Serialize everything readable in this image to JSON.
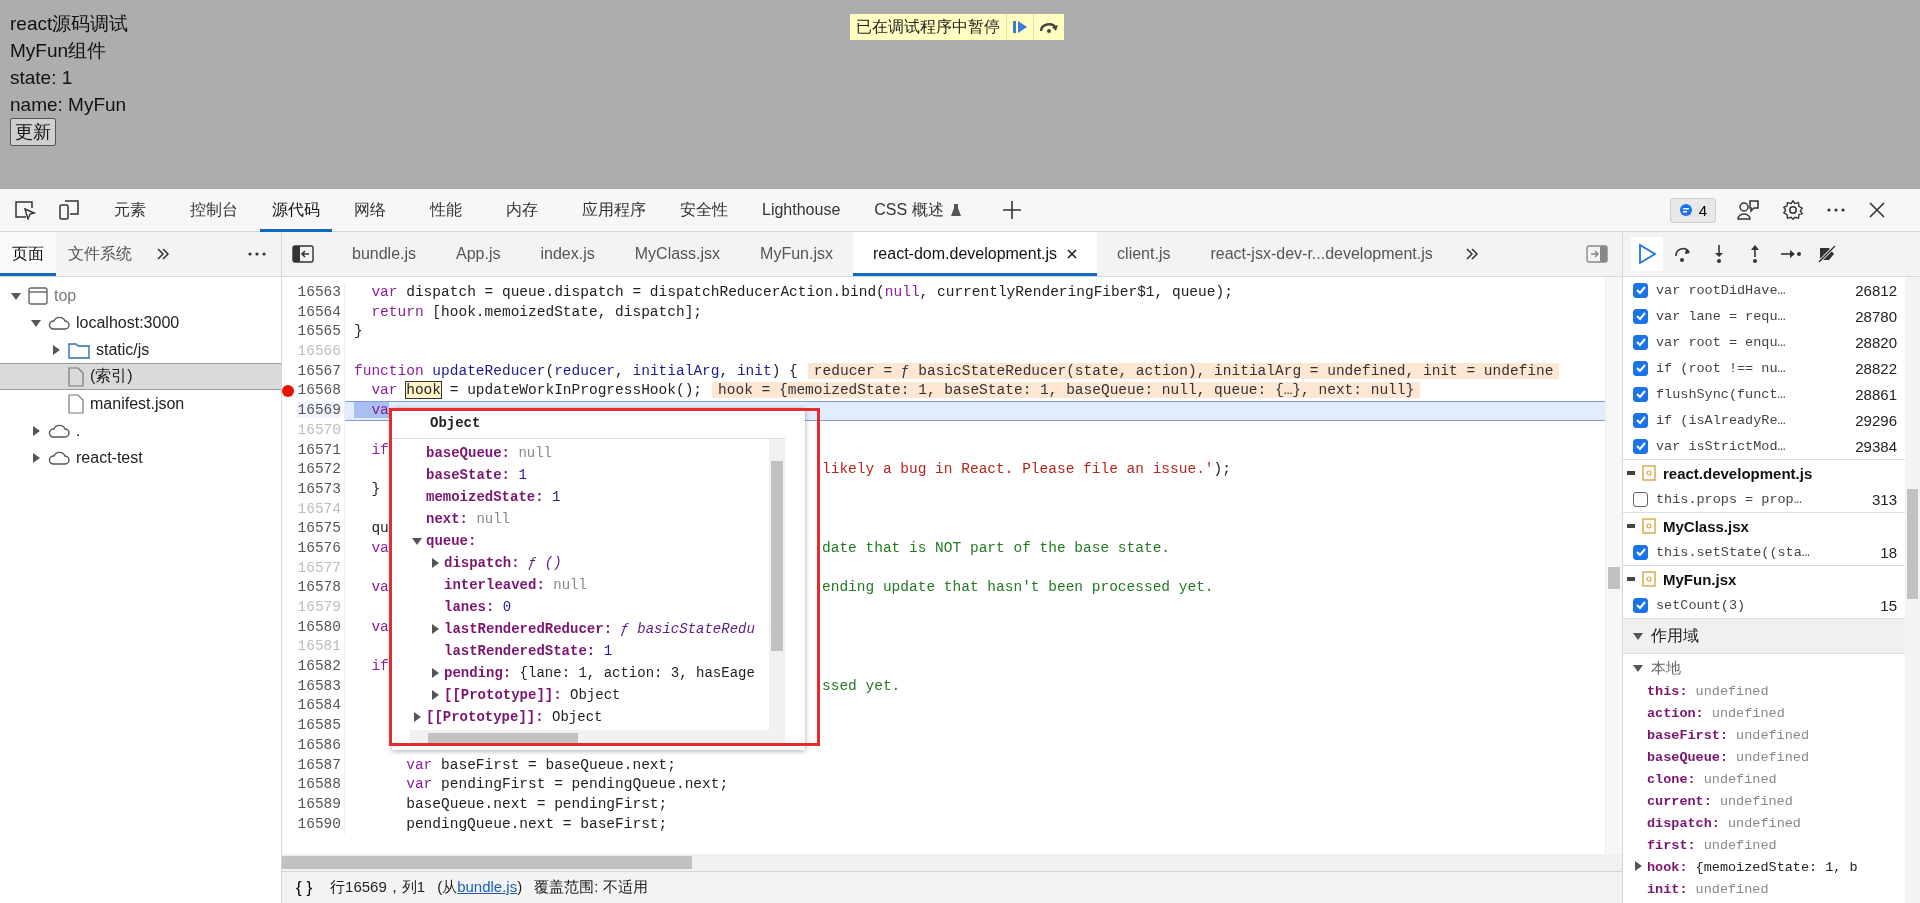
{
  "page": {
    "lines": [
      "react源码调试",
      "MyFun组件",
      "state: 1",
      "name: MyFun"
    ],
    "button": "更新"
  },
  "paused_banner": {
    "text": "已在调试程序中暂停"
  },
  "devtools_tabs": [
    {
      "label": "元素",
      "selected": false,
      "experimental": false
    },
    {
      "label": "控制台",
      "selected": false,
      "experimental": false
    },
    {
      "label": "源代码",
      "selected": true,
      "experimental": false
    },
    {
      "label": "网络",
      "selected": false,
      "experimental": false
    },
    {
      "label": "性能",
      "selected": false,
      "experimental": false
    },
    {
      "label": "内存",
      "selected": false,
      "experimental": false
    },
    {
      "label": "应用程序",
      "selected": false,
      "experimental": false
    },
    {
      "label": "安全性",
      "selected": false,
      "experimental": false
    },
    {
      "label": "Lighthouse",
      "selected": false,
      "experimental": false
    },
    {
      "label": "CSS 概述",
      "selected": false,
      "experimental": true
    }
  ],
  "issues_badge": {
    "count": "4"
  },
  "navigator": {
    "tabs": [
      {
        "label": "页面",
        "selected": true
      },
      {
        "label": "文件系统",
        "selected": false
      }
    ],
    "tree": [
      {
        "label": "top",
        "kind": "frame",
        "expanded": true,
        "selected": false,
        "children": [
          {
            "label": "localhost:3000",
            "kind": "domain",
            "expanded": true,
            "selected": false,
            "children": [
              {
                "label": "static/js",
                "kind": "folder",
                "expanded": false,
                "selected": false
              },
              {
                "label": "(索引)",
                "kind": "file",
                "selected": true
              },
              {
                "label": "manifest.json",
                "kind": "file",
                "selected": false
              }
            ]
          },
          {
            "label": ".",
            "kind": "domain",
            "expanded": false,
            "selected": false
          },
          {
            "label": "react-test",
            "kind": "domain",
            "expanded": false,
            "selected": false
          }
        ]
      }
    ]
  },
  "editor": {
    "tabs": [
      {
        "label": "bundle.js",
        "selected": false
      },
      {
        "label": "App.js",
        "selected": false
      },
      {
        "label": "index.js",
        "selected": false
      },
      {
        "label": "MyClass.jsx",
        "selected": false
      },
      {
        "label": "MyFun.jsx",
        "selected": false
      },
      {
        "label": "react-dom.development.js",
        "selected": true
      },
      {
        "label": "client.js",
        "selected": false
      },
      {
        "label": "react-jsx-dev-r...development.js",
        "selected": false
      }
    ],
    "lines": [
      {
        "number": "16563",
        "breakable": true,
        "breakpoint": false,
        "current": false,
        "tokens": [
          {
            "kind": "keyword",
            "text": "  var"
          },
          {
            "kind": "plain",
            "text": " dispatch = queue.dispatch = dispatchReducerAction.bind("
          },
          {
            "kind": "keyword",
            "text": "null"
          },
          {
            "kind": "plain",
            "text": ", currentlyRenderingFiber$1, queue);"
          }
        ]
      },
      {
        "number": "16564",
        "breakable": true,
        "breakpoint": false,
        "current": false,
        "tokens": [
          {
            "kind": "keyword",
            "text": "  return"
          },
          {
            "kind": "plain",
            "text": " [hook.memoizedState, dispatch];"
          }
        ]
      },
      {
        "number": "16565",
        "breakable": true,
        "breakpoint": false,
        "current": false,
        "tokens": [
          {
            "kind": "plain",
            "text": "}"
          }
        ]
      },
      {
        "number": "16566",
        "breakable": false,
        "breakpoint": false,
        "current": false
      },
      {
        "number": "16567",
        "breakable": true,
        "breakpoint": false,
        "current": false,
        "tokens": [
          {
            "kind": "keyword",
            "text": "function "
          },
          {
            "kind": "def",
            "text": "updateReducer"
          },
          {
            "kind": "plain",
            "text": "("
          },
          {
            "kind": "def",
            "text": "reducer"
          },
          {
            "kind": "plain",
            "text": ", "
          },
          {
            "kind": "def",
            "text": "initialArg"
          },
          {
            "kind": "plain",
            "text": ", "
          },
          {
            "kind": "def",
            "text": "init"
          },
          {
            "kind": "plain",
            "text": ") {"
          }
        ],
        "inline_value": "reducer = ƒ basicStateReducer(state, action), initialArg = undefined, init = undefine"
      },
      {
        "number": "16568",
        "breakable": true,
        "breakpoint": true,
        "current": false,
        "tokens": [
          {
            "kind": "keyword",
            "text": "  var "
          },
          {
            "kind": "hover",
            "text": "hook"
          },
          {
            "kind": "plain",
            "text": " = updateWorkInProgressHook();"
          }
        ],
        "inline_value": "hook = {memoizedState: 1, baseState: 1, baseQueue: null, queue: {…}, next: null}"
      },
      {
        "number": "16569",
        "breakable": true,
        "breakpoint": false,
        "current": true,
        "tokens": [
          {
            "kind": "keyword",
            "text": "  va"
          }
        ]
      },
      {
        "number": "16570",
        "breakable": false,
        "breakpoint": false,
        "current": false
      },
      {
        "number": "16571",
        "breakable": true,
        "breakpoint": false,
        "current": false,
        "tokens": [
          {
            "kind": "keyword",
            "text": "  if"
          }
        ]
      },
      {
        "number": "16572",
        "breakable": true,
        "breakpoint": false,
        "current": false,
        "right": [
          {
            "kind": "string",
            "text": "likely a bug in React. Please file an issue.'"
          },
          {
            "kind": "plain",
            "text": ");"
          }
        ]
      },
      {
        "number": "16573",
        "breakable": true,
        "breakpoint": false,
        "current": false,
        "tokens": [
          {
            "kind": "plain",
            "text": "  }"
          }
        ]
      },
      {
        "number": "16574",
        "breakable": false,
        "breakpoint": false,
        "current": false
      },
      {
        "number": "16575",
        "breakable": true,
        "breakpoint": false,
        "current": false,
        "tokens": [
          {
            "kind": "plain",
            "text": "  qu"
          }
        ]
      },
      {
        "number": "16576",
        "breakable": true,
        "breakpoint": false,
        "current": false,
        "tokens": [
          {
            "kind": "keyword",
            "text": "  va"
          }
        ],
        "right": [
          {
            "kind": "comment",
            "text": "date that is NOT part of the base state."
          }
        ]
      },
      {
        "number": "16577",
        "breakable": false,
        "breakpoint": false,
        "current": false
      },
      {
        "number": "16578",
        "breakable": true,
        "breakpoint": false,
        "current": false,
        "tokens": [
          {
            "kind": "keyword",
            "text": "  va"
          }
        ],
        "right": [
          {
            "kind": "comment",
            "text": "ending update that hasn't been processed yet."
          }
        ]
      },
      {
        "number": "16579",
        "breakable": false,
        "breakpoint": false,
        "current": false
      },
      {
        "number": "16580",
        "breakable": true,
        "breakpoint": false,
        "current": false,
        "tokens": [
          {
            "kind": "keyword",
            "text": "  va"
          }
        ]
      },
      {
        "number": "16581",
        "breakable": false,
        "breakpoint": false,
        "current": false
      },
      {
        "number": "16582",
        "breakable": true,
        "breakpoint": false,
        "current": false,
        "tokens": [
          {
            "kind": "keyword",
            "text": "  if"
          }
        ]
      },
      {
        "number": "16583",
        "breakable": true,
        "breakpoint": false,
        "current": false,
        "right": [
          {
            "kind": "comment",
            "text": "ssed yet."
          }
        ]
      },
      {
        "number": "16584",
        "breakable": true,
        "breakpoint": false,
        "current": false
      },
      {
        "number": "16585",
        "breakable": true,
        "breakpoint": false,
        "current": false
      },
      {
        "number": "16586",
        "breakable": true,
        "breakpoint": false,
        "current": false
      },
      {
        "number": "16587",
        "breakable": true,
        "breakpoint": false,
        "current": false,
        "tokens": [
          {
            "kind": "keyword",
            "text": "      var"
          },
          {
            "kind": "plain",
            "text": " baseFirst = baseQueue.next;"
          }
        ]
      },
      {
        "number": "16588",
        "breakable": true,
        "breakpoint": false,
        "current": false,
        "tokens": [
          {
            "kind": "keyword",
            "text": "      var"
          },
          {
            "kind": "plain",
            "text": " pendingFirst = pendingQueue.next;"
          }
        ]
      },
      {
        "number": "16589",
        "breakable": true,
        "breakpoint": false,
        "current": false,
        "tokens": [
          {
            "kind": "plain",
            "text": "      baseQueue.next = pendingFirst;"
          }
        ]
      },
      {
        "number": "16590",
        "breakable": true,
        "breakpoint": false,
        "current": false,
        "tokens": [
          {
            "kind": "plain",
            "text": "      pendingQueue.next = baseFirst;"
          }
        ]
      }
    ],
    "popover": {
      "title": "Object",
      "entries": [
        {
          "name": "baseQueue:",
          "value": "null",
          "kind": "null"
        },
        {
          "name": "baseState:",
          "value": "1",
          "kind": "number"
        },
        {
          "name": "memoizedState:",
          "value": "1",
          "kind": "number"
        },
        {
          "name": "next:",
          "value": "null",
          "kind": "null"
        },
        {
          "name": "queue:",
          "expanded": true,
          "children": [
            {
              "name": "dispatch:",
              "value": "ƒ ()",
              "kind": "function",
              "expanded": false
            },
            {
              "name": "interleaved:",
              "value": "null",
              "kind": "null"
            },
            {
              "name": "lanes:",
              "value": "0",
              "kind": "number"
            },
            {
              "name": "lastRenderedReducer:",
              "value": "ƒ basicStateRedu",
              "kind": "function",
              "expanded": false
            },
            {
              "name": "lastRenderedState:",
              "value": "1",
              "kind": "number"
            },
            {
              "name": "pending:",
              "value": "{lane: 1, action: 3, hasEage",
              "kind": "preview",
              "expanded": false
            },
            {
              "name": "[[Prototype]]:",
              "value": "Object",
              "kind": "object",
              "expanded": false
            }
          ]
        },
        {
          "name": "[[Prototype]]:",
          "value": "Object",
          "kind": "object",
          "expanded": false
        }
      ]
    }
  },
  "status_bar": {
    "format_button": "{ }",
    "position": "行16569，列1",
    "source_prefix": "(从",
    "source_link": "bundle.js",
    "source_suffix": ")",
    "coverage": "覆盖范围: 不适用"
  },
  "breakpoints": [
    {
      "rows": [
        {
          "code": "var rootDidHave…",
          "line": "26812",
          "checked": true
        },
        {
          "code": "var lane = requ…",
          "line": "28780",
          "checked": true
        },
        {
          "code": "var root = enqu…",
          "line": "28820",
          "checked": true
        },
        {
          "code": "if (root !== nu…",
          "line": "28822",
          "checked": true
        },
        {
          "code": "flushSync(funct…",
          "line": "28861",
          "checked": true
        },
        {
          "code": "if (isAlreadyRe…",
          "line": "29296",
          "checked": true
        },
        {
          "code": "var isStrictMod…",
          "line": "29384",
          "checked": true
        }
      ]
    },
    {
      "file": "react.development.js",
      "rows": [
        {
          "code": "this.props = prop…",
          "line": "313",
          "checked": false
        }
      ]
    },
    {
      "file": "MyClass.jsx",
      "rows": [
        {
          "code": "this.setState((sta…",
          "line": "18",
          "checked": true
        }
      ]
    },
    {
      "file": "MyFun.jsx",
      "rows": [
        {
          "code": "setCount(3)",
          "line": "15",
          "checked": true
        }
      ]
    }
  ],
  "scope": {
    "title": "作用域",
    "expanded": true,
    "groups": [
      {
        "title": "本地",
        "expanded": true,
        "entries": [
          {
            "name": "this:",
            "value": "undefined",
            "kind": "undefined"
          },
          {
            "name": "action:",
            "value": "undefined",
            "kind": "undefined"
          },
          {
            "name": "baseFirst:",
            "value": "undefined",
            "kind": "undefined"
          },
          {
            "name": "baseQueue:",
            "value": "undefined",
            "kind": "undefined"
          },
          {
            "name": "clone:",
            "value": "undefined",
            "kind": "undefined"
          },
          {
            "name": "current:",
            "value": "undefined",
            "kind": "undefined"
          },
          {
            "name": "dispatch:",
            "value": "undefined",
            "kind": "undefined"
          },
          {
            "name": "first:",
            "value": "undefined",
            "kind": "undefined"
          },
          {
            "name": "hook:",
            "value": "{memoizedState: 1, b",
            "kind": "preview",
            "expanded": false
          },
          {
            "name": "init:",
            "value": "undefined",
            "kind": "undefined"
          }
        ]
      }
    ]
  }
}
